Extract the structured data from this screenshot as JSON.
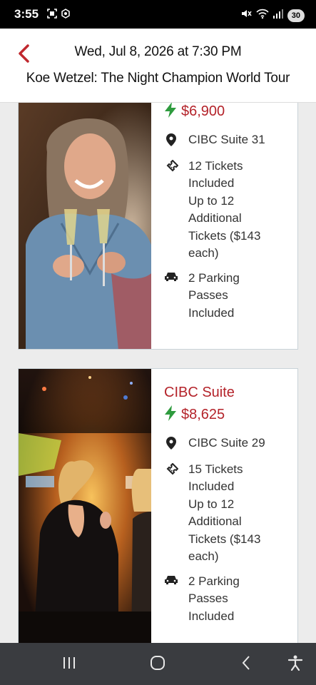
{
  "status_bar": {
    "time": "3:55",
    "battery": "30"
  },
  "header": {
    "date_time": "Wed, Jul 8, 2026 at 7:30 PM",
    "event_name": "Koe Wetzel: The Night Champion World Tour"
  },
  "listings": [
    {
      "price": "$6,900",
      "location": "CIBC Suite 31",
      "tickets_lines": [
        "12 Tickets",
        "Included",
        "Up to 12",
        "Additional",
        "Tickets ($143",
        "each)"
      ],
      "parking_lines": [
        "2 Parking",
        "Passes",
        "Included"
      ]
    },
    {
      "suite_name": "CIBC Suite",
      "price": "$8,625",
      "location": "CIBC Suite 29",
      "tickets_lines": [
        "15 Tickets",
        "Included",
        "Up to 12",
        "Additional",
        "Tickets ($143",
        "each)"
      ],
      "parking_lines": [
        "2 Parking",
        "Passes",
        "Included"
      ]
    }
  ],
  "colors": {
    "accent_red": "#b4232a",
    "bolt_green": "#2e9b3e"
  },
  "icons": [
    "back-chevron-icon",
    "lightning-icon",
    "location-pin-icon",
    "ticket-icon",
    "car-icon"
  ]
}
